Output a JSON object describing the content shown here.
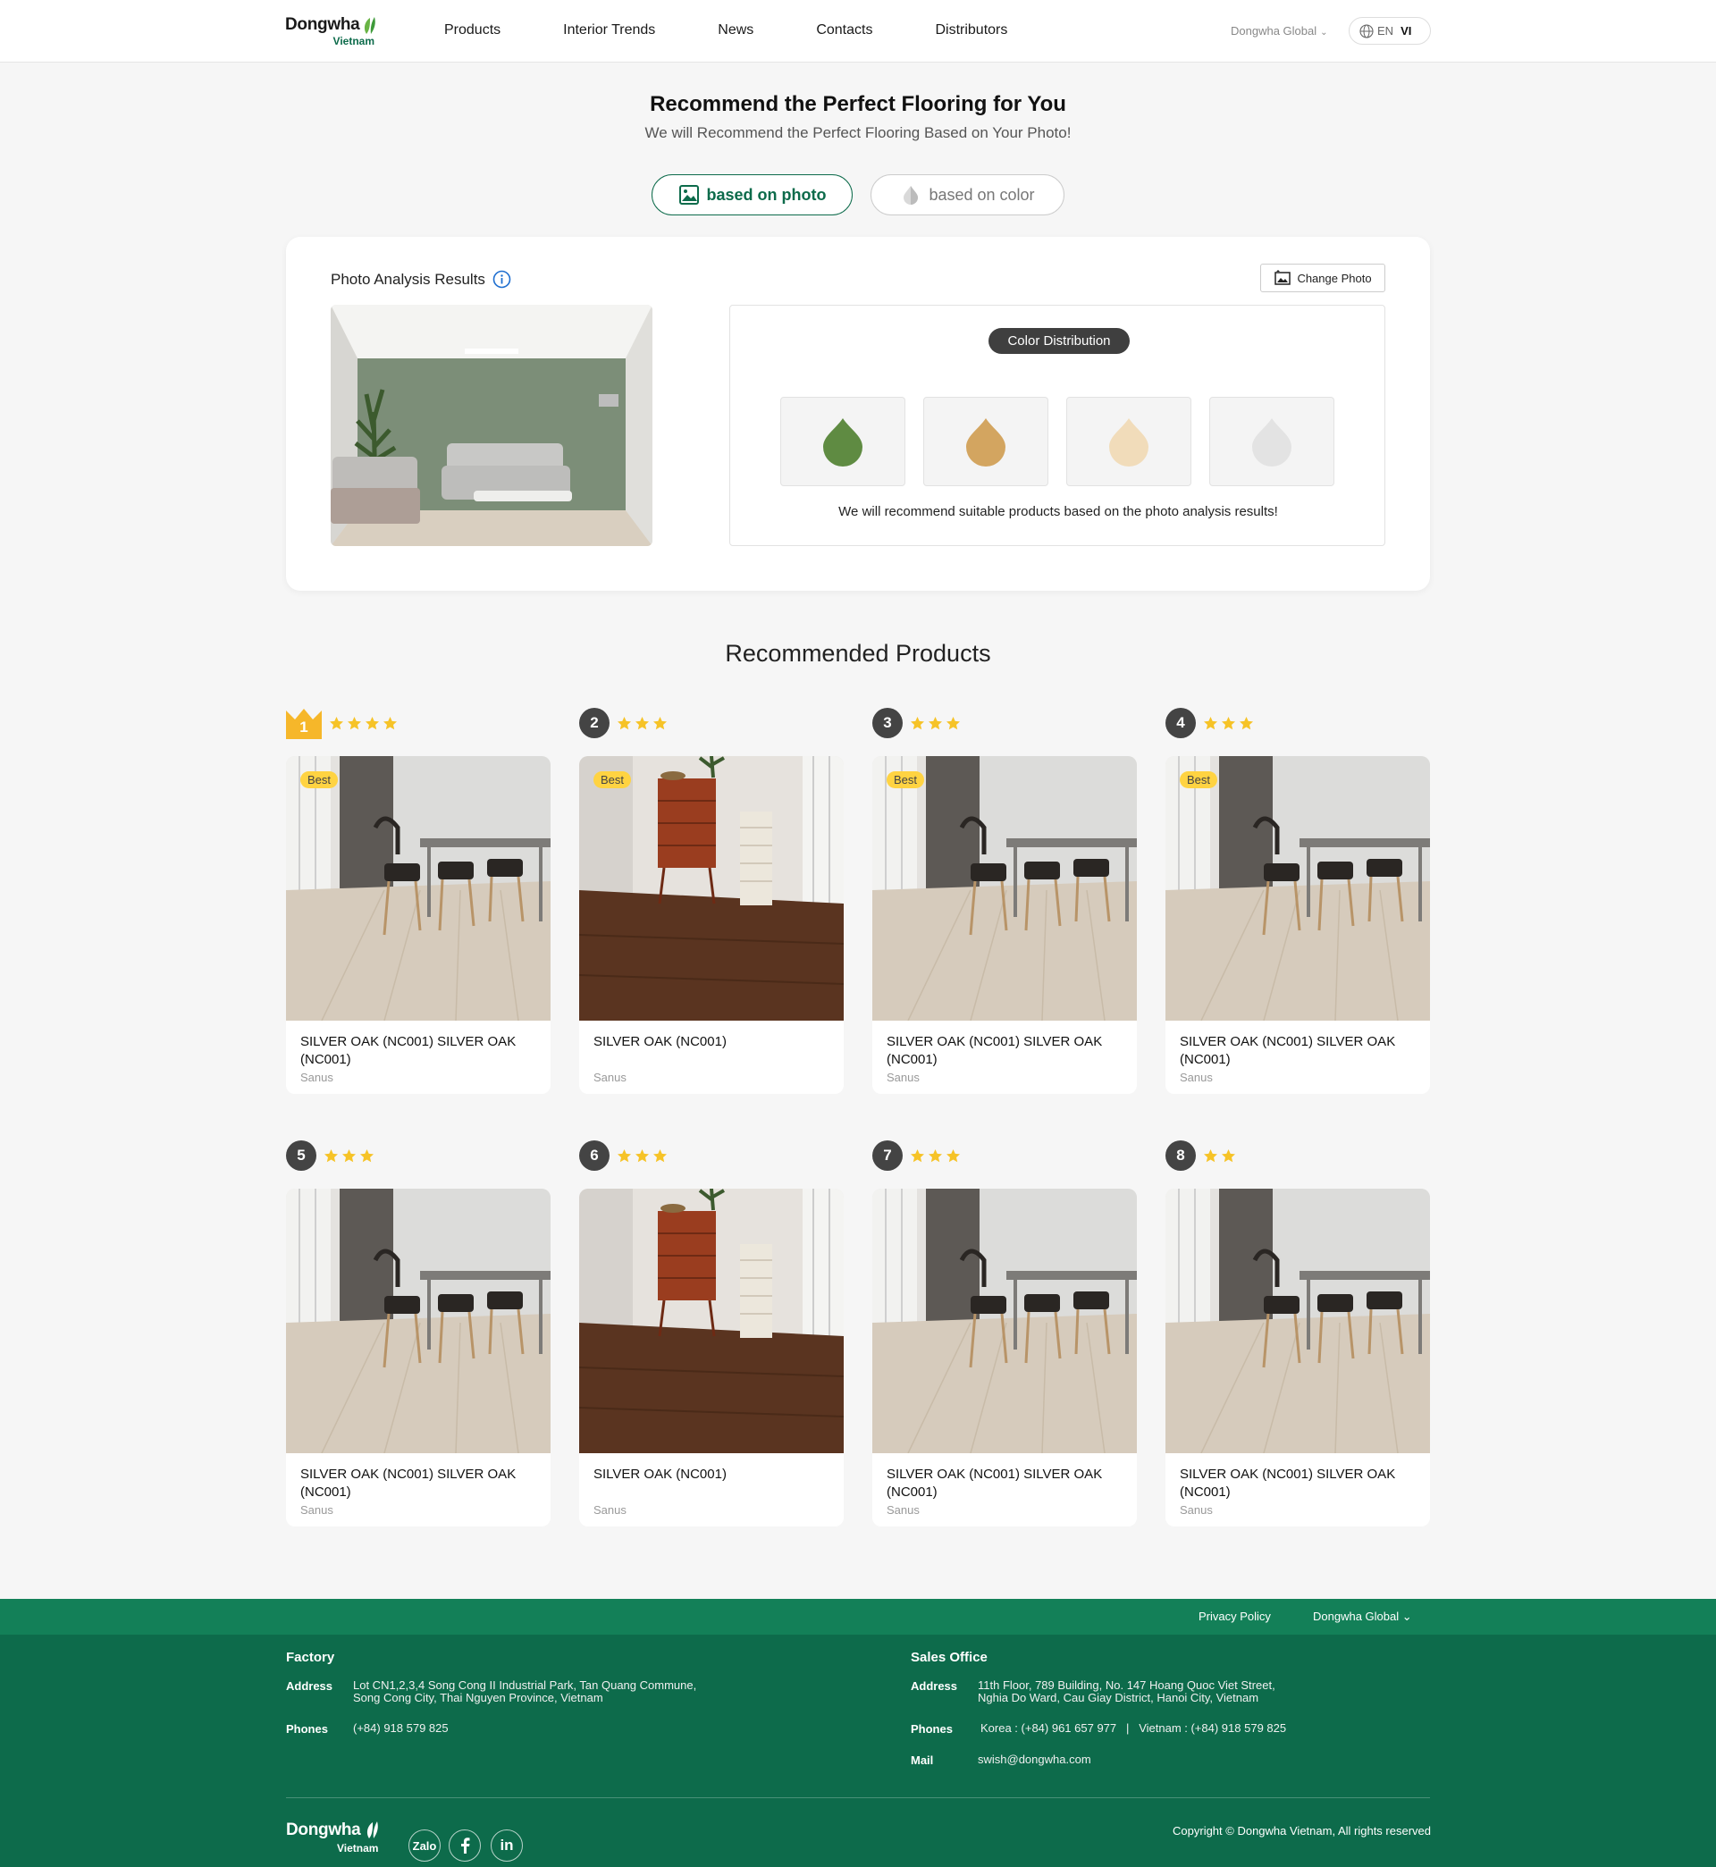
{
  "header": {
    "logo_text": "Dongwha",
    "logo_sub": "Vietnam",
    "nav": [
      "Products",
      "Interior Trends",
      "News",
      "Contacts",
      "Distributors"
    ],
    "global_select": "Dongwha Global",
    "lang_en": "EN",
    "lang_vi": "VI"
  },
  "hero": {
    "title": "Recommend the Perfect Flooring for You",
    "subtitle": "We will Recommend the Perfect Flooring Based on Your Photo!",
    "mode_photo": "based on photo",
    "mode_color": "based on color"
  },
  "analysis": {
    "title": "Photo Analysis Results",
    "change_photo": "Change Photo",
    "color_distribution": "Color Distribution",
    "swatches": [
      "#5f8b42",
      "#d3a560",
      "#f1dcba",
      "#e3e3e3"
    ],
    "note": "We will recommend suitable products based on the photo analysis results!"
  },
  "recommended": {
    "title": "Recommended Products",
    "products": [
      {
        "rank": "1",
        "stars": 4,
        "best": "Best",
        "name": "SILVER OAK (NC001) SILVER OAK (NC001)",
        "brand": "Sanus",
        "image": "light"
      },
      {
        "rank": "2",
        "stars": 3,
        "best": "Best",
        "name": "SILVER OAK (NC001)",
        "brand": "Sanus",
        "image": "dark"
      },
      {
        "rank": "3",
        "stars": 3,
        "best": "Best",
        "name": "SILVER OAK (NC001) SILVER OAK (NC001)",
        "brand": "Sanus",
        "image": "light"
      },
      {
        "rank": "4",
        "stars": 3,
        "best": "Best",
        "name": "SILVER OAK (NC001) SILVER OAK (NC001)",
        "brand": "Sanus",
        "image": "light"
      },
      {
        "rank": "5",
        "stars": 3,
        "best": "",
        "name": "SILVER OAK (NC001) SILVER OAK (NC001)",
        "brand": "Sanus",
        "image": "light"
      },
      {
        "rank": "6",
        "stars": 3,
        "best": "",
        "name": "SILVER OAK (NC001)",
        "brand": "Sanus",
        "image": "dark"
      },
      {
        "rank": "7",
        "stars": 3,
        "best": "",
        "name": "SILVER OAK (NC001) SILVER OAK (NC001)",
        "brand": "Sanus",
        "image": "light"
      },
      {
        "rank": "8",
        "stars": 2,
        "best": "",
        "name": "SILVER OAK (NC001) SILVER OAK (NC001)",
        "brand": "Sanus",
        "image": "light"
      }
    ]
  },
  "footer": {
    "privacy": "Privacy Policy",
    "global": "Dongwha Global",
    "factory": {
      "heading": "Factory",
      "address_label": "Address",
      "address_line1": "Lot CN1,2,3,4 Song Cong II Industrial Park, Tan Quang Commune,",
      "address_line2": "Song Cong City, Thai Nguyen Province, Vietnam",
      "phones_label": "Phones",
      "phones": "(+84) 918 579 825"
    },
    "sales": {
      "heading": "Sales Office",
      "address_label": "Address",
      "address_line1": "11th Floor, 789 Building, No. 147 Hoang Quoc Viet Street,",
      "address_line2": "Nghia Do Ward, Cau Giay District, Hanoi City, Vietnam",
      "phones_label": "Phones",
      "phones": "Korea : (+84) 961 657 977   |   Vietnam : (+84) 918 579 825",
      "mail_label": "Mail",
      "mail": "swish@dongwha.com"
    },
    "logo_text": "Dongwha",
    "logo_sub": "Vietnam",
    "zalo": "Zalo",
    "copyright": "Copyright © Dongwha Vietnam, All rights reserved"
  },
  "colors": {
    "brand_green": "#0d6b4b",
    "star": "#f6c327",
    "badge": "#ffd342"
  }
}
